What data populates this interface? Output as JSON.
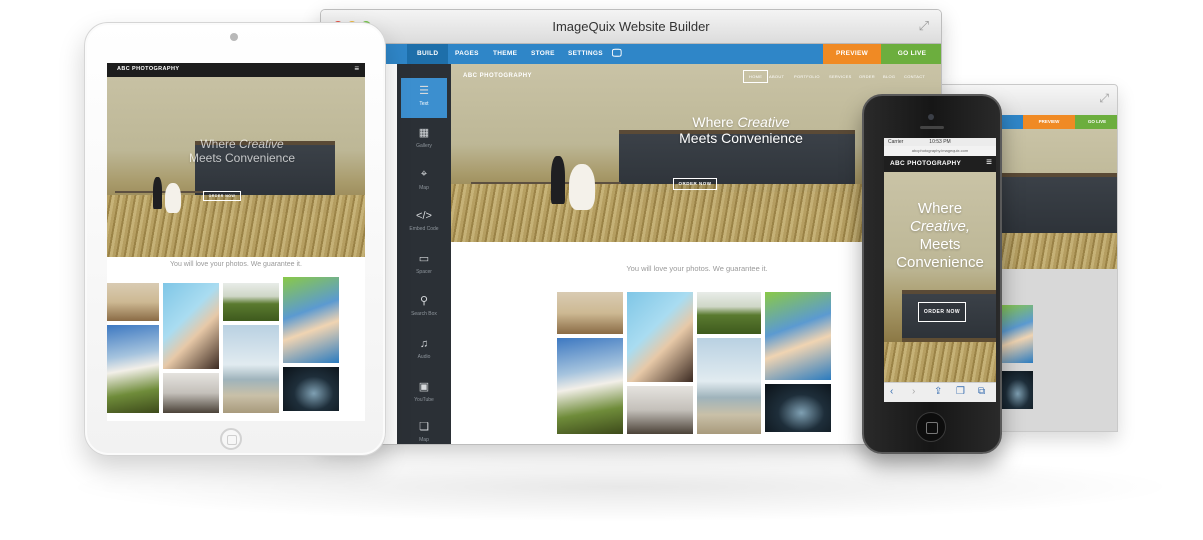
{
  "window": {
    "title": "ImageQuix Website Builder"
  },
  "builder_nav": {
    "build": "BUILD",
    "pages": "PAGES",
    "theme": "THEME",
    "store": "STORE",
    "settings": "SETTINGS",
    "preview": "PREVIEW",
    "go_live": "GO LIVE"
  },
  "sidebar": {
    "items": [
      {
        "label": "Text",
        "icon": "text-lines-icon"
      },
      {
        "label": "Gallery",
        "icon": "grid-icon"
      },
      {
        "label": "Map",
        "icon": "map-pin-icon"
      },
      {
        "label": "Embed Code",
        "icon": "code-icon"
      },
      {
        "label": "Spacer",
        "icon": "spacer-icon"
      },
      {
        "label": "Search Box",
        "icon": "search-icon"
      },
      {
        "label": "Audio",
        "icon": "music-note-icon"
      },
      {
        "label": "YouTube",
        "icon": "video-icon"
      },
      {
        "label": "Map",
        "icon": "map-icon"
      }
    ]
  },
  "site": {
    "brand": "ABC PHOTOGRAPHY",
    "nav": [
      "HOME",
      "ABOUT",
      "PORTFOLIO",
      "SERVICES",
      "ORDER",
      "BLOG",
      "CONTACT"
    ],
    "hero_line1": "Where",
    "hero_emph": "Creative",
    "hero_line2": "Meets Convenience",
    "order_button": "ORDER NOW",
    "tagline": "You will love your photos. We guarantee it."
  },
  "phone": {
    "carrier": "Carrier",
    "time": "10:53 PM",
    "url": "abcphotography.imagequix.com",
    "hero_where": "Where",
    "hero_creative": "Creative,",
    "hero_meets": "Meets",
    "hero_convenience": "Convenience",
    "order_button": "ORDER NOW"
  },
  "colors": {
    "nav_blue": "#2f86c8",
    "preview_orange": "#f08a24",
    "golive_green": "#6cae3e",
    "sidebar_dark": "#2b3036"
  }
}
